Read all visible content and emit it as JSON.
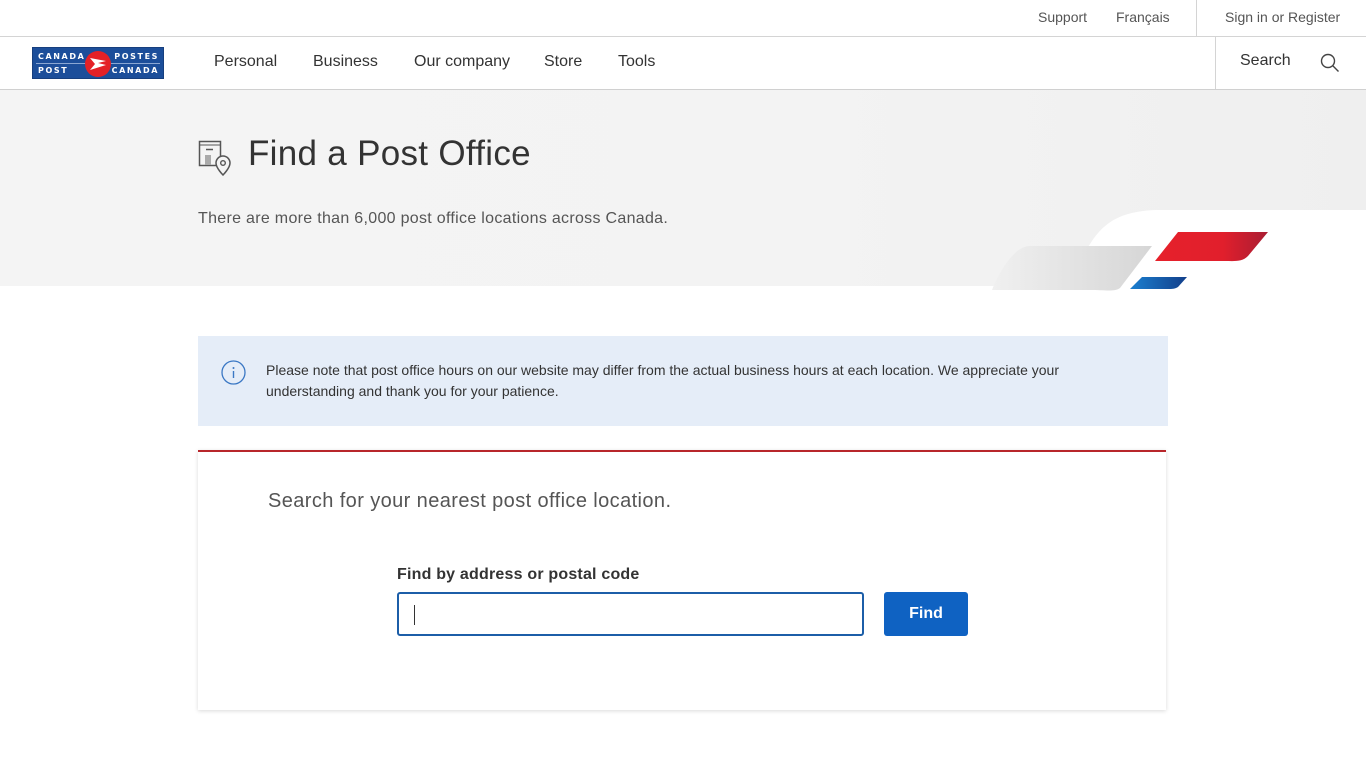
{
  "utility": {
    "support": "Support",
    "language": "Français",
    "signin": "Sign in or Register"
  },
  "logo": {
    "top_left": "CANADA",
    "bottom_left": "POST",
    "top_right": "POSTES",
    "bottom_right": "CANADA",
    "colors": {
      "blue": "#1c4e9a",
      "red": "#e42127"
    }
  },
  "nav": {
    "items": [
      {
        "label": "Personal"
      },
      {
        "label": "Business"
      },
      {
        "label": "Our company"
      },
      {
        "label": "Store"
      },
      {
        "label": "Tools"
      }
    ],
    "search_label": "Search",
    "search_icon": "search-icon"
  },
  "hero": {
    "icon": "post-office-location-icon",
    "title": "Find a Post Office",
    "subtitle": "There are more than 6,000 post office locations across Canada."
  },
  "notice": {
    "icon": "info-icon",
    "text": "Please note that post office hours on our website may differ from the actual business hours at each location. We appreciate your understanding and thank you for your patience."
  },
  "search_card": {
    "heading": "Search for your nearest post office location.",
    "field_label": "Find by address or postal code",
    "field_value": "",
    "find_button": "Find",
    "accent_color": "#b8262b",
    "button_color": "#0f62c2"
  }
}
